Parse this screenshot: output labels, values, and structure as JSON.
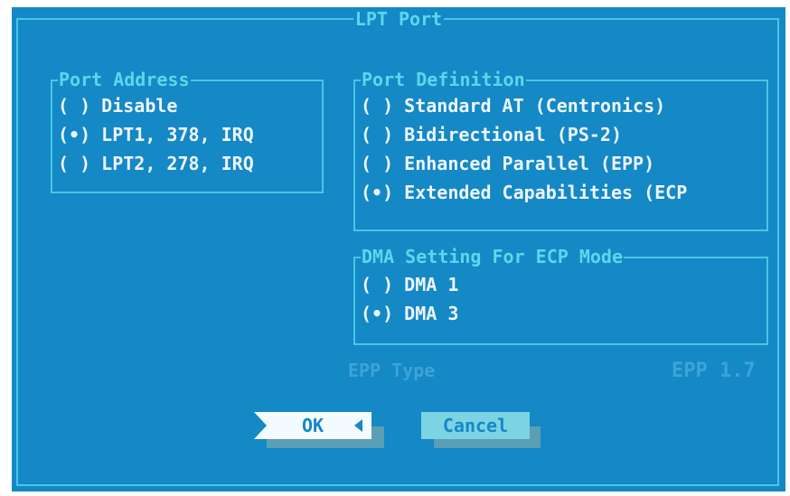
{
  "dialog": {
    "title": "LPT Port"
  },
  "port_address": {
    "title": "Port Address",
    "options": [
      {
        "radio": "( )",
        "label": "Disable",
        "selected": false
      },
      {
        "radio": "(•)",
        "label": "LPT1, 378, IRQ",
        "selected": true
      },
      {
        "radio": "( )",
        "label": "LPT2, 278, IRQ",
        "selected": false
      }
    ]
  },
  "port_definition": {
    "title": "Port Definition",
    "options": [
      {
        "radio": "( )",
        "label": "Standard AT (Centronics)",
        "selected": false
      },
      {
        "radio": "( )",
        "label": "Bidirectional (PS-2)",
        "selected": false
      },
      {
        "radio": "( )",
        "label": "Enhanced Parallel (EPP)",
        "selected": false
      },
      {
        "radio": "(•)",
        "label": "Extended Capabilities (ECP",
        "selected": true
      }
    ]
  },
  "dma_setting": {
    "title": "DMA Setting For ECP Mode",
    "options": [
      {
        "radio": "( )",
        "label": "DMA 1",
        "selected": false
      },
      {
        "radio": "(•)",
        "label": "DMA 3",
        "selected": true
      }
    ]
  },
  "epp_type": {
    "label": "EPP Type",
    "value": "EPP 1.7"
  },
  "buttons": {
    "ok_label": "OK",
    "cancel_label": "Cancel"
  },
  "colors": {
    "background": "#1588c6",
    "frame": "#46c8e6",
    "text": "#eef6ff",
    "title_text": "#5fd5ec",
    "disabled_text": "#3ea3d6"
  }
}
